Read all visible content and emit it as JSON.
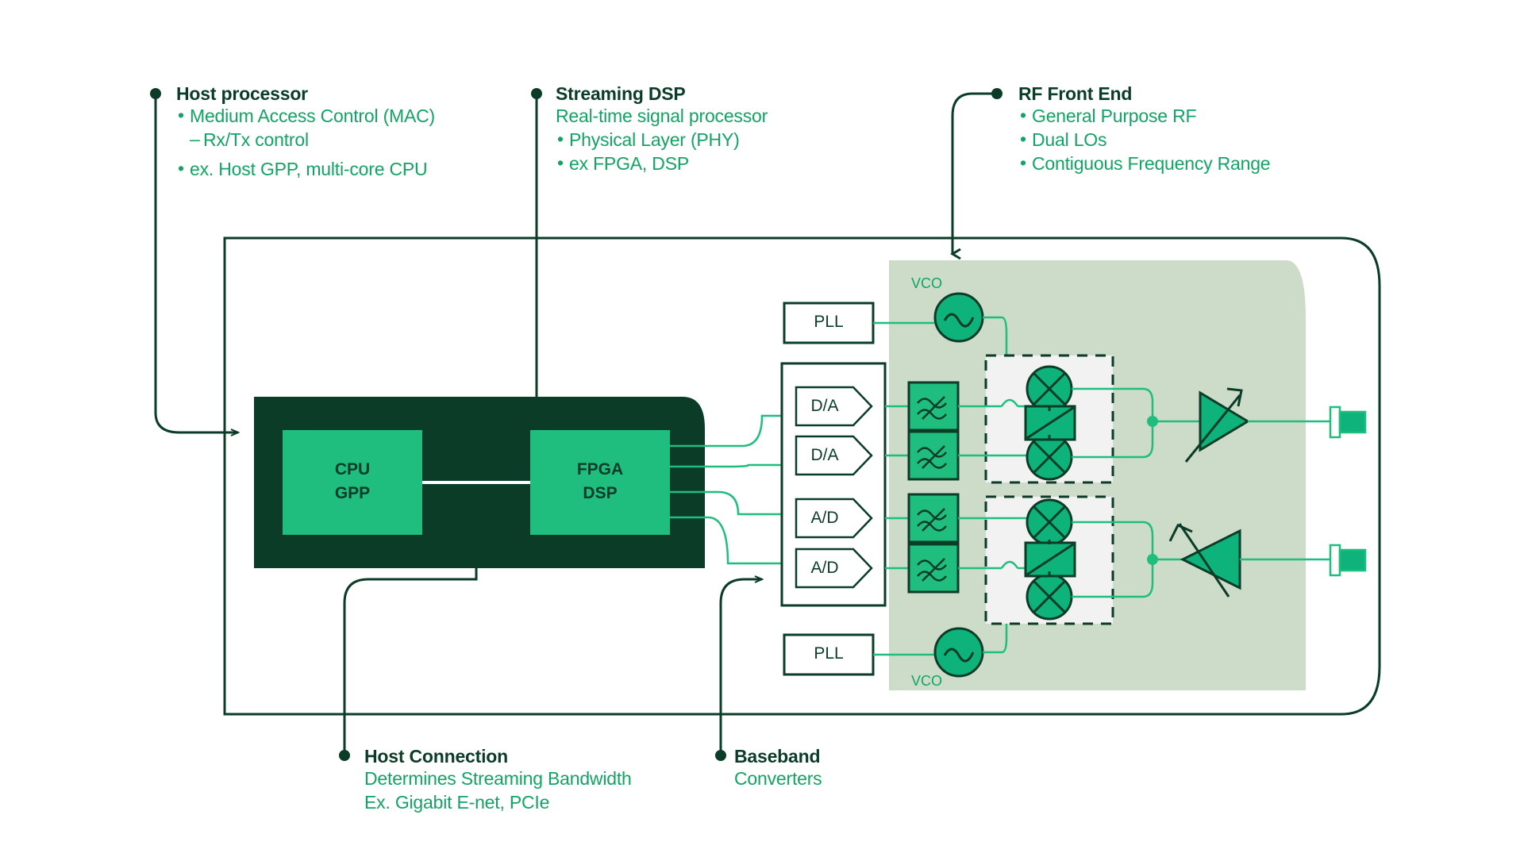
{
  "theme": {
    "bg": "#ffffff",
    "dark_green": "#0b3c28",
    "mid_green": "#12a464",
    "bright_green": "#1fbd7e",
    "core_fill": "#0b3c28",
    "chip_fill": "#1fbd7e",
    "rf_region_fill": "#ccdcc8",
    "quad_box_fill": "#f2f2f2"
  },
  "callouts": [
    {
      "id": "host-processor",
      "title": "Host processor",
      "bullets": [
        {
          "text": "Medium Access Control (MAC)",
          "style": "bullet"
        },
        {
          "text": "Rx/Tx control",
          "style": "dash"
        },
        {
          "text": "ex. Host GPP, multi-core CPU",
          "style": "bullet"
        }
      ]
    },
    {
      "id": "streaming-dsp",
      "title": "Streaming DSP",
      "sub": "Real-time signal processor",
      "bullets": [
        {
          "text": "Physical Layer (PHY)",
          "style": "bullet"
        },
        {
          "text": "ex FPGA, DSP",
          "style": "bullet"
        }
      ]
    },
    {
      "id": "rf-front-end",
      "title": "RF Front End",
      "bullets": [
        {
          "text": "General Purpose RF",
          "style": "bullet"
        },
        {
          "text": "Dual LOs",
          "style": "bullet"
        },
        {
          "text": "Contiguous Frequency Range",
          "style": "bullet"
        }
      ]
    },
    {
      "id": "host-connection",
      "title": "Host Connection",
      "lines": [
        "Determines Streaming Bandwidth",
        "Ex. Gigabit E-net, PCIe"
      ]
    },
    {
      "id": "baseband",
      "title": "Baseband",
      "lines": [
        "Converters"
      ]
    }
  ],
  "blocks": {
    "cpu": {
      "line1": "CPU",
      "line2": "GPP"
    },
    "fpga": {
      "line1": "FPGA",
      "line2": "DSP"
    },
    "converters": [
      {
        "label": "D/A"
      },
      {
        "label": "D/A"
      },
      {
        "label": "A/D"
      },
      {
        "label": "A/D"
      }
    ],
    "pll_top": "PLL",
    "pll_bottom": "PLL",
    "vco_top": "VCO",
    "vco_bottom": "VCO"
  },
  "icons": {
    "mixer": "mixer-icon",
    "phase_shifter": "phase-shifter-icon",
    "filter": "filter-icon",
    "vco_osc": "oscillator-icon",
    "amplifier_tx": "variable-gain-amplifier-icon",
    "amplifier_rx": "variable-gain-amplifier-icon",
    "connector": "rf-connector-icon"
  }
}
